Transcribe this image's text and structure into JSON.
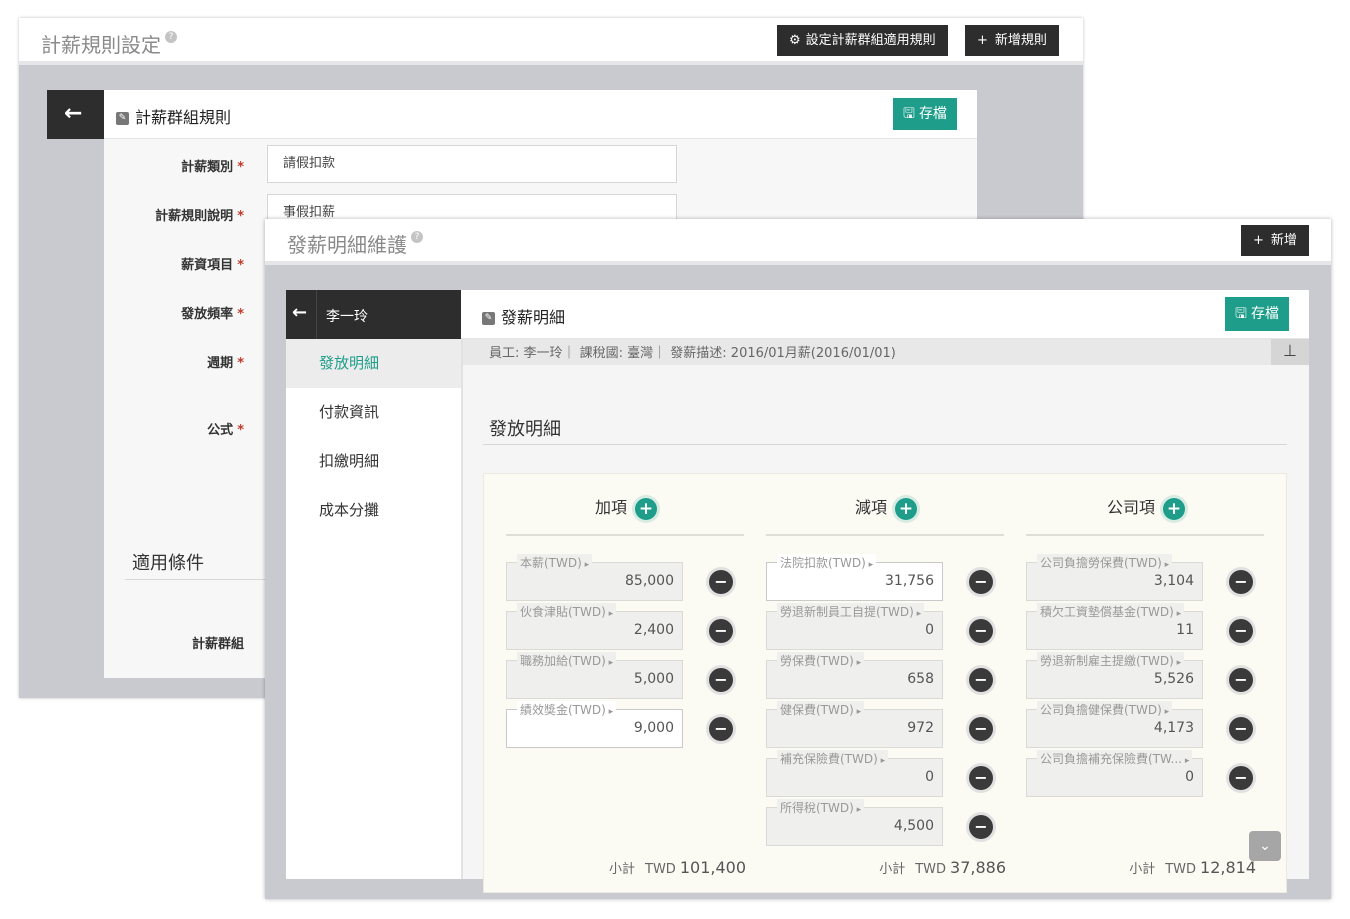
{
  "rule_window": {
    "title": "計薪規則設定",
    "btn_group_rule": "設定計薪群組適用規則",
    "btn_add_rule": "新增規則",
    "panel_title": "計薪群組規則",
    "save_label": "存檔",
    "fields": [
      {
        "label": "計薪類別",
        "value": "請假扣款"
      },
      {
        "label": "計薪規則說明",
        "value": "事假扣薪"
      },
      {
        "label": "薪資項目"
      },
      {
        "label": "發放頻率"
      },
      {
        "label": "週期"
      },
      {
        "label": "公式"
      }
    ],
    "section": "適用條件",
    "group_label": "計薪群組"
  },
  "detail_window": {
    "title": "發薪明細維護",
    "btn_add": "新增",
    "employee_name": "李一玲",
    "panel_title": "發薪明細",
    "save_label": "存檔",
    "info": "員工: 李一玲｜ 課稅國: 臺灣｜ 發薪描述: 2016/01月薪(2016/01/01)",
    "sidebar": [
      "發放明細",
      "付款資訊",
      "扣繳明細",
      "成本分攤"
    ],
    "section_title": "發放明細",
    "columns": [
      {
        "title": "加項",
        "items": [
          {
            "label": "本薪(TWD)",
            "value": "85,000",
            "editable": false
          },
          {
            "label": "伙食津貼(TWD)",
            "value": "2,400",
            "editable": false
          },
          {
            "label": "職務加給(TWD)",
            "value": "5,000",
            "editable": false
          },
          {
            "label": "績效獎金(TWD)",
            "value": "9,000",
            "editable": true
          }
        ],
        "subtotal_label": "小計",
        "currency": "TWD",
        "subtotal": "101,400"
      },
      {
        "title": "減項",
        "items": [
          {
            "label": "法院扣款(TWD)",
            "value": "31,756",
            "editable": true
          },
          {
            "label": "勞退新制員工自提(TWD)",
            "value": "0",
            "editable": false
          },
          {
            "label": "勞保費(TWD)",
            "value": "658",
            "editable": false
          },
          {
            "label": "健保費(TWD)",
            "value": "972",
            "editable": false
          },
          {
            "label": "補充保險費(TWD)",
            "value": "0",
            "editable": false
          },
          {
            "label": "所得稅(TWD)",
            "value": "4,500",
            "editable": false
          }
        ],
        "subtotal_label": "小計",
        "currency": "TWD",
        "subtotal": "37,886"
      },
      {
        "title": "公司項",
        "items": [
          {
            "label": "公司負擔勞保費(TWD)",
            "value": "3,104",
            "editable": false
          },
          {
            "label": "積欠工資墊償基金(TWD)",
            "value": "11",
            "editable": false
          },
          {
            "label": "勞退新制雇主提繳(TWD)",
            "value": "5,526",
            "editable": false
          },
          {
            "label": "公司負擔健保費(TWD)",
            "value": "4,173",
            "editable": false
          },
          {
            "label": "公司負擔補充保險費(TW...",
            "value": "0",
            "editable": false
          }
        ],
        "subtotal_label": "小計",
        "currency": "TWD",
        "subtotal": "12,814"
      }
    ]
  }
}
